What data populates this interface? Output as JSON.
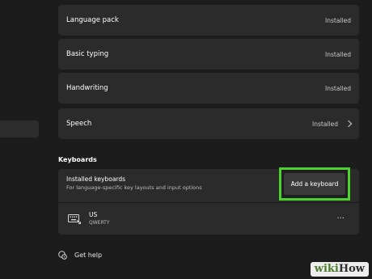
{
  "features": [
    {
      "label": "Language pack",
      "status": "Installed"
    },
    {
      "label": "Basic typing",
      "status": "Installed"
    },
    {
      "label": "Handwriting",
      "status": "Installed"
    },
    {
      "label": "Speech",
      "status": "Installed"
    }
  ],
  "keyboards": {
    "heading": "Keyboards",
    "installed_title": "Installed keyboards",
    "installed_subtitle": "For language-specific key layouts and input options",
    "add_button_label": "Add a keyboard",
    "items": [
      {
        "name": "US",
        "layout": "QWERTY",
        "more": "···"
      }
    ]
  },
  "help": {
    "label": "Get help"
  },
  "watermark": {
    "part1": "wiki",
    "part2": "How"
  },
  "colors": {
    "background": "#1c1c1c",
    "card": "#2b2b2b",
    "highlight": "#4cd12d"
  }
}
